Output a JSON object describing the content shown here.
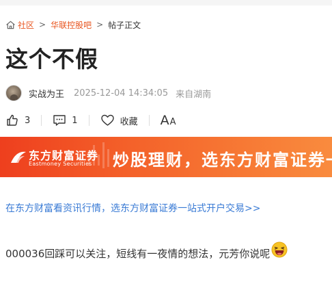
{
  "breadcrumb": {
    "home_label": "社区",
    "forum_label": "华联控股吧",
    "current_label": "帖子正文",
    "separator": ">"
  },
  "post": {
    "title": "这个不假",
    "author": "实战为王",
    "time": "2025-12-04 14:34:05",
    "location": "来自湖南",
    "body": "000036回踩可以关注，短线有一夜情的想法，元芳你说呢"
  },
  "actions": {
    "like_count": "3",
    "comment_count": "1",
    "favorite_label": "收藏",
    "font_big": "A",
    "font_small": "A"
  },
  "banner": {
    "brand": "东方财富证券",
    "brand_en": "Eastmoney Securities",
    "slogan": "炒股理财，选东方财富证券一"
  },
  "promo": {
    "text": "在东方财富看资讯行情，选东方财富证券一站式开户交易>>"
  },
  "colors": {
    "accent": "#e8541e",
    "link": "#3a7bd5",
    "banner_start": "#ee3f1e",
    "banner_end": "#f98b3e",
    "muted": "#999999"
  },
  "icons": {
    "home": "home-icon",
    "like": "thumbs-up-icon",
    "comment": "comment-icon",
    "favorite": "heart-icon",
    "emoji": "laughing-emoji-icon"
  }
}
